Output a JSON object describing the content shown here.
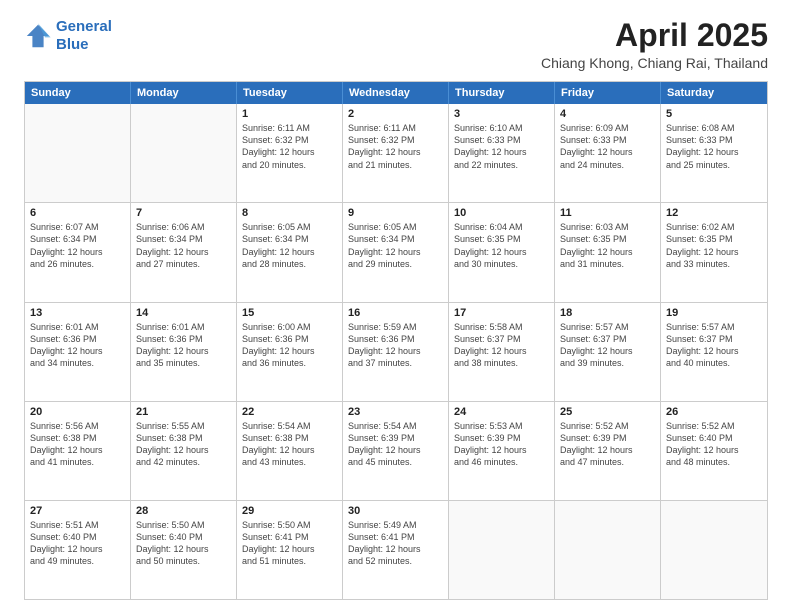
{
  "header": {
    "logo_line1": "General",
    "logo_line2": "Blue",
    "title": "April 2025",
    "subtitle": "Chiang Khong, Chiang Rai, Thailand"
  },
  "days_of_week": [
    "Sunday",
    "Monday",
    "Tuesday",
    "Wednesday",
    "Thursday",
    "Friday",
    "Saturday"
  ],
  "weeks": [
    [
      {
        "day": "",
        "info": ""
      },
      {
        "day": "",
        "info": ""
      },
      {
        "day": "1",
        "info": "Sunrise: 6:11 AM\nSunset: 6:32 PM\nDaylight: 12 hours\nand 20 minutes."
      },
      {
        "day": "2",
        "info": "Sunrise: 6:11 AM\nSunset: 6:32 PM\nDaylight: 12 hours\nand 21 minutes."
      },
      {
        "day": "3",
        "info": "Sunrise: 6:10 AM\nSunset: 6:33 PM\nDaylight: 12 hours\nand 22 minutes."
      },
      {
        "day": "4",
        "info": "Sunrise: 6:09 AM\nSunset: 6:33 PM\nDaylight: 12 hours\nand 24 minutes."
      },
      {
        "day": "5",
        "info": "Sunrise: 6:08 AM\nSunset: 6:33 PM\nDaylight: 12 hours\nand 25 minutes."
      }
    ],
    [
      {
        "day": "6",
        "info": "Sunrise: 6:07 AM\nSunset: 6:34 PM\nDaylight: 12 hours\nand 26 minutes."
      },
      {
        "day": "7",
        "info": "Sunrise: 6:06 AM\nSunset: 6:34 PM\nDaylight: 12 hours\nand 27 minutes."
      },
      {
        "day": "8",
        "info": "Sunrise: 6:05 AM\nSunset: 6:34 PM\nDaylight: 12 hours\nand 28 minutes."
      },
      {
        "day": "9",
        "info": "Sunrise: 6:05 AM\nSunset: 6:34 PM\nDaylight: 12 hours\nand 29 minutes."
      },
      {
        "day": "10",
        "info": "Sunrise: 6:04 AM\nSunset: 6:35 PM\nDaylight: 12 hours\nand 30 minutes."
      },
      {
        "day": "11",
        "info": "Sunrise: 6:03 AM\nSunset: 6:35 PM\nDaylight: 12 hours\nand 31 minutes."
      },
      {
        "day": "12",
        "info": "Sunrise: 6:02 AM\nSunset: 6:35 PM\nDaylight: 12 hours\nand 33 minutes."
      }
    ],
    [
      {
        "day": "13",
        "info": "Sunrise: 6:01 AM\nSunset: 6:36 PM\nDaylight: 12 hours\nand 34 minutes."
      },
      {
        "day": "14",
        "info": "Sunrise: 6:01 AM\nSunset: 6:36 PM\nDaylight: 12 hours\nand 35 minutes."
      },
      {
        "day": "15",
        "info": "Sunrise: 6:00 AM\nSunset: 6:36 PM\nDaylight: 12 hours\nand 36 minutes."
      },
      {
        "day": "16",
        "info": "Sunrise: 5:59 AM\nSunset: 6:36 PM\nDaylight: 12 hours\nand 37 minutes."
      },
      {
        "day": "17",
        "info": "Sunrise: 5:58 AM\nSunset: 6:37 PM\nDaylight: 12 hours\nand 38 minutes."
      },
      {
        "day": "18",
        "info": "Sunrise: 5:57 AM\nSunset: 6:37 PM\nDaylight: 12 hours\nand 39 minutes."
      },
      {
        "day": "19",
        "info": "Sunrise: 5:57 AM\nSunset: 6:37 PM\nDaylight: 12 hours\nand 40 minutes."
      }
    ],
    [
      {
        "day": "20",
        "info": "Sunrise: 5:56 AM\nSunset: 6:38 PM\nDaylight: 12 hours\nand 41 minutes."
      },
      {
        "day": "21",
        "info": "Sunrise: 5:55 AM\nSunset: 6:38 PM\nDaylight: 12 hours\nand 42 minutes."
      },
      {
        "day": "22",
        "info": "Sunrise: 5:54 AM\nSunset: 6:38 PM\nDaylight: 12 hours\nand 43 minutes."
      },
      {
        "day": "23",
        "info": "Sunrise: 5:54 AM\nSunset: 6:39 PM\nDaylight: 12 hours\nand 45 minutes."
      },
      {
        "day": "24",
        "info": "Sunrise: 5:53 AM\nSunset: 6:39 PM\nDaylight: 12 hours\nand 46 minutes."
      },
      {
        "day": "25",
        "info": "Sunrise: 5:52 AM\nSunset: 6:39 PM\nDaylight: 12 hours\nand 47 minutes."
      },
      {
        "day": "26",
        "info": "Sunrise: 5:52 AM\nSunset: 6:40 PM\nDaylight: 12 hours\nand 48 minutes."
      }
    ],
    [
      {
        "day": "27",
        "info": "Sunrise: 5:51 AM\nSunset: 6:40 PM\nDaylight: 12 hours\nand 49 minutes."
      },
      {
        "day": "28",
        "info": "Sunrise: 5:50 AM\nSunset: 6:40 PM\nDaylight: 12 hours\nand 50 minutes."
      },
      {
        "day": "29",
        "info": "Sunrise: 5:50 AM\nSunset: 6:41 PM\nDaylight: 12 hours\nand 51 minutes."
      },
      {
        "day": "30",
        "info": "Sunrise: 5:49 AM\nSunset: 6:41 PM\nDaylight: 12 hours\nand 52 minutes."
      },
      {
        "day": "",
        "info": ""
      },
      {
        "day": "",
        "info": ""
      },
      {
        "day": "",
        "info": ""
      }
    ]
  ],
  "accent_color": "#2a6ebb"
}
